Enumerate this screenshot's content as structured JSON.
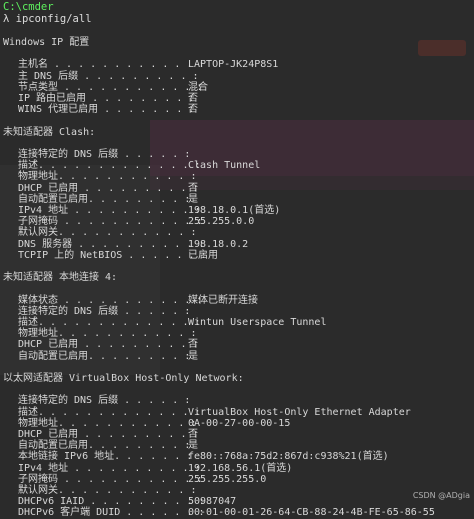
{
  "window": {
    "title": "C:\\cmder"
  },
  "prompt": {
    "symbol": "λ",
    "command": "ipconfig/all"
  },
  "watermark": "CSDN @ADgia",
  "lines": [
    {
      "type": "section",
      "key": "Windows IP 配置",
      "value": ""
    },
    {
      "type": "blank"
    },
    {
      "type": "indent",
      "key": "主机名 . . . . . . . . . . . . :",
      "value": "LAPTOP-JK24P8S1"
    },
    {
      "type": "indent",
      "key": "主 DNS 后缀 . . . . . . . . . :",
      "value": ""
    },
    {
      "type": "indent",
      "key": "节点类型 . . . . . . . . . . . :",
      "value": "混合"
    },
    {
      "type": "indent",
      "key": "IP 路由已启用 . . . . . . . . :",
      "value": "否"
    },
    {
      "type": "indent",
      "key": "WINS 代理已启用 . . . . . . . :",
      "value": "否"
    },
    {
      "type": "blank"
    },
    {
      "type": "section",
      "key": "未知适配器 Clash:",
      "value": ""
    },
    {
      "type": "blank"
    },
    {
      "type": "indent",
      "key": "连接特定的 DNS 后缀 . . . . . :",
      "value": ""
    },
    {
      "type": "indent",
      "key": "描述. . . . . . . . . . . . . :",
      "value": "Clash Tunnel"
    },
    {
      "type": "indent",
      "key": "物理地址. . . . . . . . . . . :",
      "value": ""
    },
    {
      "type": "indent",
      "key": "DHCP 已启用 . . . . . . . . . :",
      "value": "否"
    },
    {
      "type": "indent",
      "key": "自动配置已启用. . . . . . . . :",
      "value": "是"
    },
    {
      "type": "indent",
      "key": "IPv4 地址 . . . . . . . . . . :",
      "value": "198.18.0.1(首选)"
    },
    {
      "type": "indent",
      "key": "子网掩码 . . . . . . . . . . . :",
      "value": "255.255.0.0"
    },
    {
      "type": "indent",
      "key": "默认网关. . . . . . . . . . . :",
      "value": ""
    },
    {
      "type": "indent",
      "key": "DNS 服务器 . . . . . . . . . . :",
      "value": "198.18.0.2"
    },
    {
      "type": "indent",
      "key": "TCPIP 上的 NetBIOS . . . . . . :",
      "value": "已启用"
    },
    {
      "type": "blank"
    },
    {
      "type": "section",
      "key": "未知适配器 本地连接 4:",
      "value": ""
    },
    {
      "type": "blank"
    },
    {
      "type": "indent",
      "key": "媒体状态 . . . . . . . . . . . :",
      "value": "媒体已断开连接"
    },
    {
      "type": "indent",
      "key": "连接特定的 DNS 后缀 . . . . . :",
      "value": ""
    },
    {
      "type": "indent",
      "key": "描述. . . . . . . . . . . . . :",
      "value": "Wintun Userspace Tunnel"
    },
    {
      "type": "indent",
      "key": "物理地址. . . . . . . . . . . :",
      "value": ""
    },
    {
      "type": "indent",
      "key": "DHCP 已启用 . . . . . . . . . :",
      "value": "否"
    },
    {
      "type": "indent",
      "key": "自动配置已启用. . . . . . . . :",
      "value": "是"
    },
    {
      "type": "blank"
    },
    {
      "type": "section",
      "key": "以太网适配器 VirtualBox Host-Only Network:",
      "value": ""
    },
    {
      "type": "blank"
    },
    {
      "type": "indent",
      "key": "连接特定的 DNS 后缀 . . . . . :",
      "value": ""
    },
    {
      "type": "indent",
      "key": "描述. . . . . . . . . . . . . :",
      "value": "VirtualBox Host-Only Ethernet Adapter"
    },
    {
      "type": "indent",
      "key": "物理地址. . . . . . . . . . . :",
      "value": "0A-00-27-00-00-15"
    },
    {
      "type": "indent",
      "key": "DHCP 已启用 . . . . . . . . . :",
      "value": "否"
    },
    {
      "type": "indent",
      "key": "自动配置已启用. . . . . . . . :",
      "value": "是"
    },
    {
      "type": "indent",
      "key": "本地链接 IPv6 地址. . . . . . :",
      "value": "fe80::768a:75d2:867d:c938%21(首选)"
    },
    {
      "type": "indent",
      "key": "IPv4 地址 . . . . . . . . . . :",
      "value": "192.168.56.1(首选)"
    },
    {
      "type": "indent",
      "key": "子网掩码 . . . . . . . . . . . :",
      "value": "255.255.255.0"
    },
    {
      "type": "indent",
      "key": "默认网关. . . . . . . . . . . :",
      "value": ""
    },
    {
      "type": "indent",
      "key": "DHCPv6 IAID . . . . . . . . . :",
      "value": "50987047"
    },
    {
      "type": "indent",
      "key": "DHCPv6 客户端 DUID . . . . . . :",
      "value": "00-01-00-01-26-64-CB-88-24-4B-FE-65-86-55"
    }
  ]
}
